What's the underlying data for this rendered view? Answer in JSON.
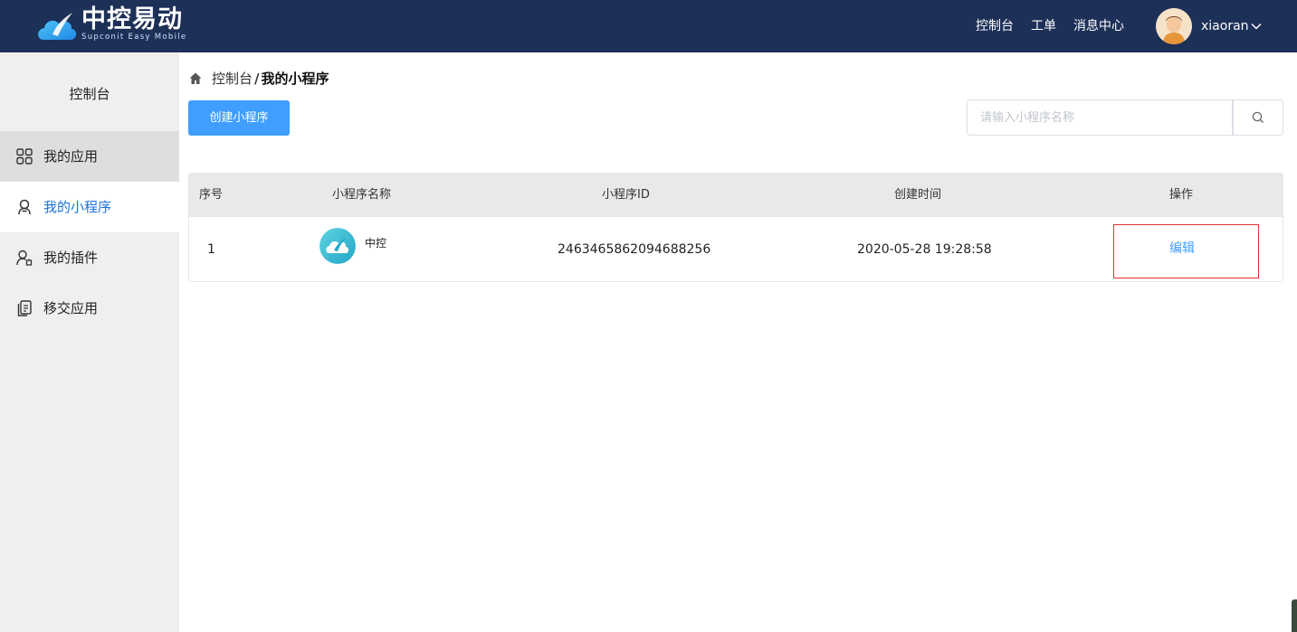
{
  "header": {
    "logo_text": "中控易动",
    "logo_sub": "Supconit Easy Mobile",
    "nav": [
      "控制台",
      "工单",
      "消息中心"
    ],
    "username": "xiaoran",
    "bg_color": "#1d3058"
  },
  "sidebar": {
    "title": "控制台",
    "items": [
      {
        "label": "我的应用",
        "icon": "apps-grid-icon",
        "state": "hover"
      },
      {
        "label": "我的小程序",
        "icon": "mini-program-icon",
        "state": "active"
      },
      {
        "label": "我的插件",
        "icon": "plugin-user-icon",
        "state": "normal"
      },
      {
        "label": "移交应用",
        "icon": "transfer-copy-icon",
        "state": "normal"
      }
    ]
  },
  "breadcrumb": {
    "home_icon": "home-icon",
    "parent": "控制台",
    "separator": "/",
    "current": "我的小程序"
  },
  "toolbar": {
    "create_label": "创建小程序",
    "search_placeholder": "请输入小程序名称",
    "search_icon": "search-icon"
  },
  "table": {
    "columns": [
      "序号",
      "小程序名称",
      "小程序ID",
      "创建时间",
      "操作"
    ],
    "rows": [
      {
        "index": "1",
        "name": "中控",
        "id": "2463465862094688256",
        "created": "2020-05-28 19:28:58",
        "action": "编辑"
      }
    ]
  },
  "colors": {
    "primary": "#409eff",
    "active_text": "#1a73d9",
    "highlight_border": "#e23232"
  }
}
